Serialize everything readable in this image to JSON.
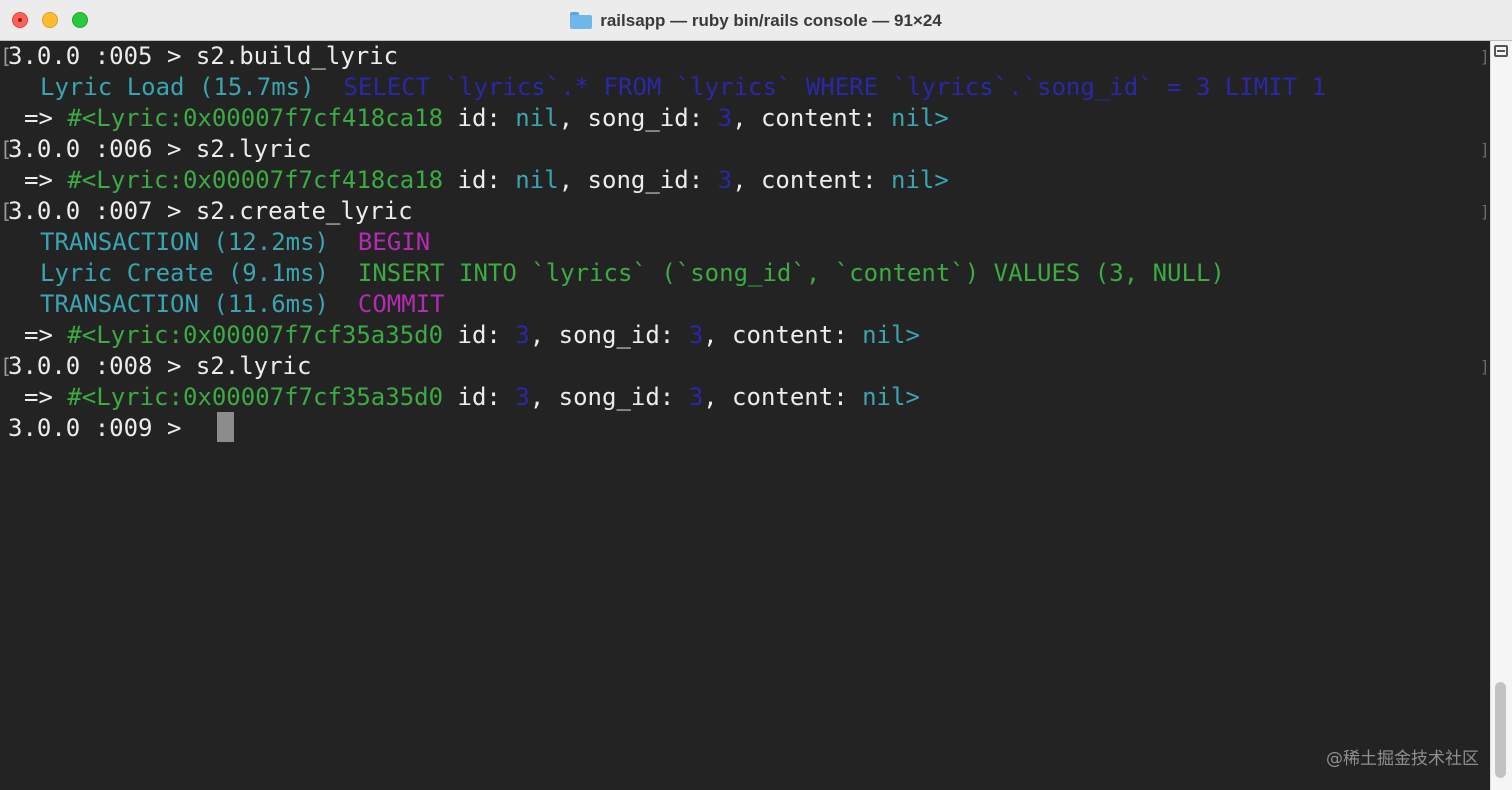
{
  "window": {
    "title": "railsapp — ruby bin/rails console — 91×24"
  },
  "console": {
    "l1": {
      "prompt": "3.0.0 :005 > ",
      "cmd": "s2.build_lyric"
    },
    "l2": {
      "label": "Lyric Load (15.7ms)",
      "sql": "SELECT `lyrics`.* FROM `lyrics` WHERE `lyrics`.`song_id` = 3 LIMIT 1"
    },
    "l3": {
      "arrow": "=> ",
      "obj": "#<Lyric:0x00007f7cf418ca18",
      "k1": " id: ",
      "v1": "nil",
      "k2": ", song_id: ",
      "v2": "3",
      "k3": ", content: ",
      "v3": "nil>"
    },
    "l4": {
      "prompt": "3.0.0 :006 > ",
      "cmd": "s2.lyric"
    },
    "l5": {
      "arrow": "=> ",
      "obj": "#<Lyric:0x00007f7cf418ca18",
      "k1": " id: ",
      "v1": "nil",
      "k2": ", song_id: ",
      "v2": "3",
      "k3": ", content: ",
      "v3": "nil>"
    },
    "l6": {
      "prompt": "3.0.0 :007 > ",
      "cmd": "s2.create_lyric"
    },
    "l7": {
      "label": "TRANSACTION (12.2ms)",
      "sql": "BEGIN"
    },
    "l8": {
      "label": "Lyric Create (9.1ms)",
      "sql": "INSERT INTO `lyrics` (`song_id`, `content`) VALUES (3, NULL)"
    },
    "l9": {
      "label": "TRANSACTION (11.6ms)",
      "sql": "COMMIT"
    },
    "l10": {
      "arrow": "=> ",
      "obj": "#<Lyric:0x00007f7cf35a35d0",
      "k1": " id: ",
      "v1": "3",
      "k2": ", song_id: ",
      "v2": "3",
      "k3": ", content: ",
      "v3": "nil>"
    },
    "l11": {
      "prompt": "3.0.0 :008 > ",
      "cmd": "s2.lyric"
    },
    "l12": {
      "arrow": "=> ",
      "obj": "#<Lyric:0x00007f7cf35a35d0",
      "k1": " id: ",
      "v1": "3",
      "k2": ", song_id: ",
      "v2": "3",
      "k3": ", content: ",
      "v3": "nil>"
    },
    "l13": {
      "prompt": "3.0.0 :009 > "
    }
  },
  "colors": {
    "background": "#232323",
    "text": "#ececec",
    "cyan": "#3aa4b0",
    "green": "#3bab42",
    "blue": "#2a28a8",
    "magenta": "#b42bb4"
  },
  "icons": {
    "close": "close-button",
    "minimize": "minimize-button",
    "zoom": "zoom-button",
    "folder": "folder-icon",
    "split": "split-pane-icon"
  },
  "watermark": "@稀土掘金技术社区"
}
